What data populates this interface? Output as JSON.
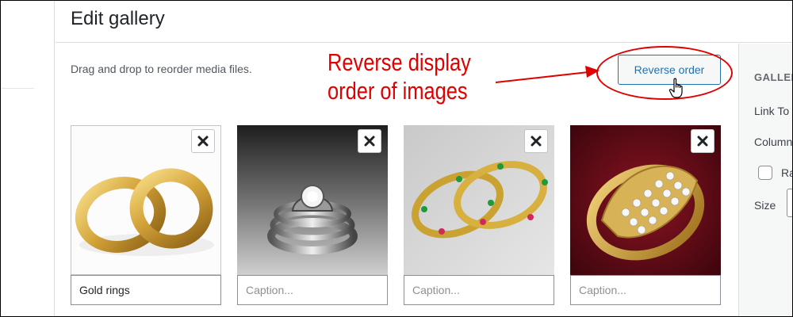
{
  "modal": {
    "title": "Edit gallery",
    "instructions": "Drag and drop to reorder media files.",
    "reverse_button": "Reverse order"
  },
  "annotation": {
    "line1": "Reverse display",
    "line2": "order of images",
    "color": "#e00000"
  },
  "sidebar": {
    "heading": "GALLER",
    "link_to": "Link To",
    "columns": "Column",
    "random_label": "Ra",
    "size": "Size"
  },
  "gallery": [
    {
      "alt": "Gold rings",
      "caption_value": "Gold rings",
      "caption_placeholder": "Caption...",
      "close_icon": "close-icon"
    },
    {
      "alt": "Diamond ring",
      "caption_value": "",
      "caption_placeholder": "Caption...",
      "close_icon": "close-icon"
    },
    {
      "alt": "Gold bangles",
      "caption_value": "",
      "caption_placeholder": "Caption...",
      "close_icon": "close-icon"
    },
    {
      "alt": "Gold diamond ring",
      "caption_value": "",
      "caption_placeholder": "Caption...",
      "close_icon": "close-icon"
    }
  ],
  "colors": {
    "accent": "#2271b1",
    "annotation_red": "#e00000"
  }
}
